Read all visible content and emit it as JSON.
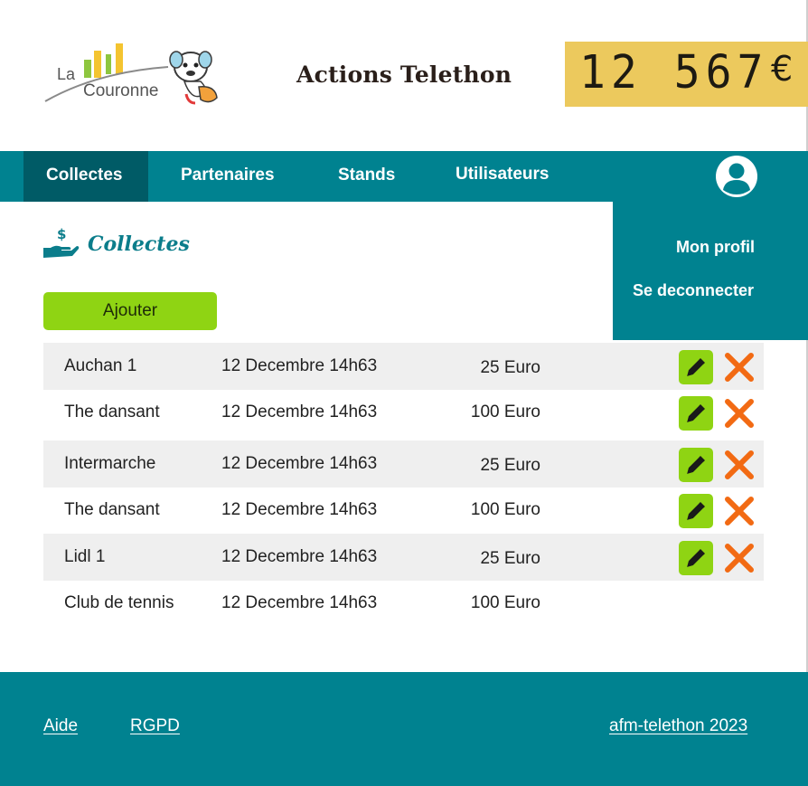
{
  "header": {
    "logo_text_top": "La",
    "logo_text_bottom": "Couronne",
    "title": "Actions Telethon",
    "counter_value": "12 567",
    "counter_currency": "€",
    "counter_color": "#ecc95d"
  },
  "nav": {
    "items": [
      {
        "label": "Collectes",
        "active": true
      },
      {
        "label": "Partenaires",
        "active": false
      },
      {
        "label": "Stands",
        "active": false
      },
      {
        "label": "Utilisateurs",
        "active": false
      }
    ],
    "avatar_icon": "user-icon",
    "color": "#008290",
    "active_color": "#005b66"
  },
  "profile_menu": {
    "items": [
      {
        "label": "Mon profil"
      },
      {
        "label": "Se deconnecter"
      }
    ]
  },
  "section": {
    "icon": "hand-money-icon",
    "title": "Collectes",
    "add_label": "Ajouter",
    "accent_color": "#8fd413"
  },
  "table": {
    "rows": [
      {
        "name": "Auchan 1",
        "date": "12 Decembre 14h63",
        "amount": "25 Euro",
        "actions": true
      },
      {
        "name": "The dansant",
        "date": "12 Decembre 14h63",
        "amount": "100 Euro",
        "actions": true
      },
      {
        "name": "Intermarche",
        "date": "12 Decembre 14h63",
        "amount": "25 Euro",
        "actions": true
      },
      {
        "name": "The dansant",
        "date": "12 Decembre 14h63",
        "amount": "100 Euro",
        "actions": true
      },
      {
        "name": "Lidl 1",
        "date": "12 Decembre 14h63",
        "amount": "25 Euro",
        "actions": true
      },
      {
        "name": "Club de tennis",
        "date": "12 Decembre 14h63",
        "amount": "100 Euro",
        "actions": false
      }
    ],
    "edit_icon": "pencil-icon",
    "delete_icon": "close-icon",
    "delete_color": "#f26a13"
  },
  "footer": {
    "links": [
      {
        "label": "Aide"
      },
      {
        "label": "RGPD"
      },
      {
        "label": "afm-telethon 2023"
      }
    ]
  }
}
